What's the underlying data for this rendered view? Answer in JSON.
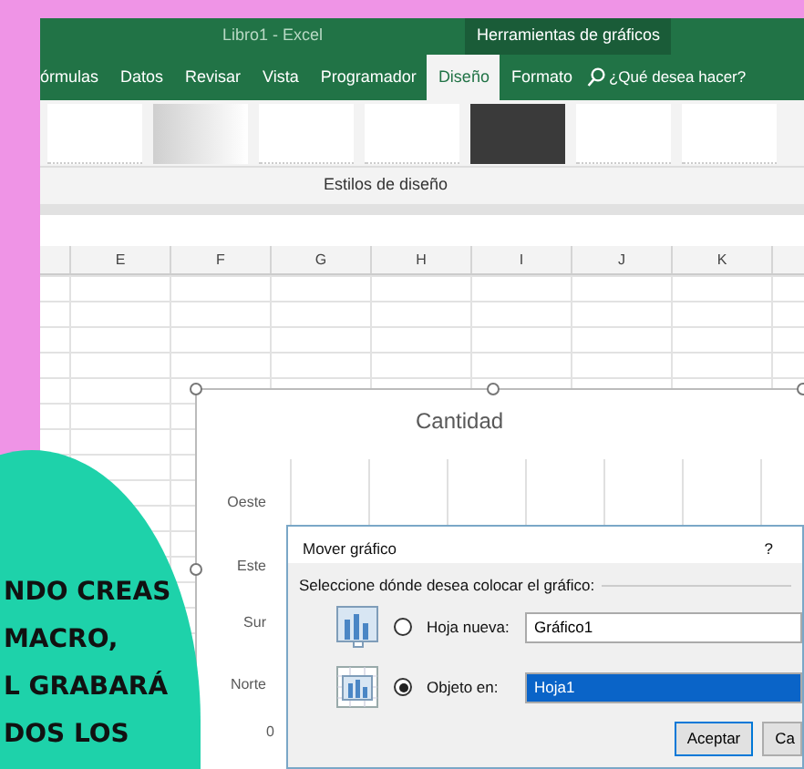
{
  "title_bar": {
    "title": "Libro1 - Excel",
    "context_label": "Herramientas de gráficos"
  },
  "ribbon_tabs": [
    {
      "label": "órmulas",
      "selected": false
    },
    {
      "label": "Datos",
      "selected": false
    },
    {
      "label": "Revisar",
      "selected": false
    },
    {
      "label": "Vista",
      "selected": false
    },
    {
      "label": "Programador",
      "selected": false
    },
    {
      "label": "Diseño",
      "selected": true
    },
    {
      "label": "Formato",
      "selected": false
    }
  ],
  "search": {
    "placeholder": "¿Qué desea hacer?"
  },
  "chart_styles": [
    {
      "kind": "light"
    },
    {
      "kind": "gradient"
    },
    {
      "kind": "light"
    },
    {
      "kind": "light"
    },
    {
      "kind": "dark"
    },
    {
      "kind": "light"
    },
    {
      "kind": "light"
    }
  ],
  "group_label": "Estilos de diseño",
  "columns": [
    "E",
    "F",
    "G",
    "H",
    "I",
    "J",
    "K"
  ],
  "chart": {
    "title": "Cantidad",
    "categories": [
      "Oeste",
      "Este",
      "Sur",
      "Norte"
    ],
    "axis_labels": [
      "0"
    ]
  },
  "dialog": {
    "title": "Mover gráfico",
    "help": "?",
    "prompt": "Seleccione dónde desea colocar el gráfico:",
    "options": [
      {
        "kind": "new_sheet",
        "label": "Hoja nueva:",
        "value": "Gráfico1",
        "selected": false
      },
      {
        "kind": "object",
        "label": "Objeto en:",
        "value": "Hoja1",
        "selected": true
      }
    ],
    "buttons": [
      {
        "label": "Aceptar",
        "default": true
      },
      {
        "label": "Ca",
        "default": false
      }
    ]
  },
  "banner": {
    "lines": [
      "NDO CREAS",
      "MACRO,",
      "L GRABARÁ",
      "DOS LOS"
    ]
  }
}
